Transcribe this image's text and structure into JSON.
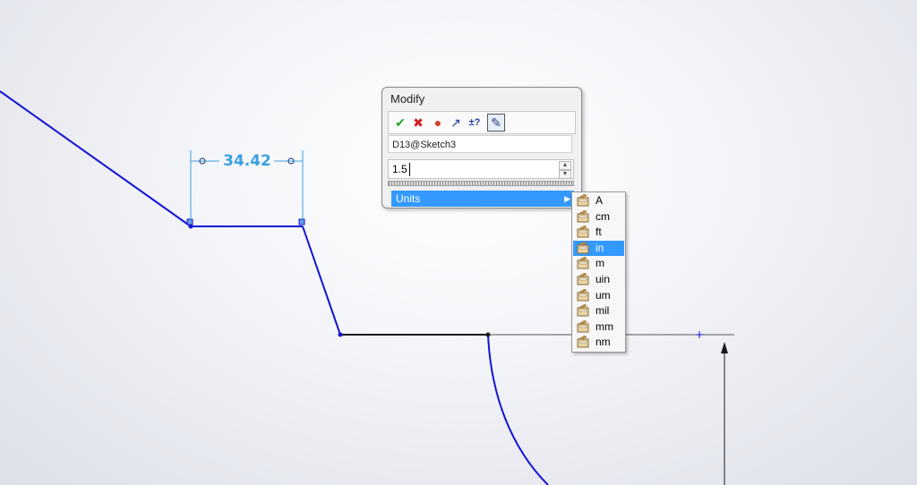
{
  "dimension": {
    "value_label": "34.42"
  },
  "modify_dialog": {
    "title": "Modify",
    "toolbar": [
      {
        "name": "ok-check-icon",
        "glyph": "✔",
        "color": "#2aa02a"
      },
      {
        "name": "cancel-x-icon",
        "glyph": "✖",
        "color": "#d02020"
      },
      {
        "name": "rebuild-traffic-light-icon",
        "glyph": "●",
        "color": "#d04030"
      },
      {
        "name": "reverse-dimension-icon",
        "glyph": "↗",
        "color": "#2040a0"
      },
      {
        "name": "tolerance-icon",
        "glyph": "±?",
        "color": "#2040a0"
      },
      {
        "name": "mark-for-drawing-icon",
        "glyph": "✎",
        "color": "#304080"
      }
    ],
    "dimension_name": "D13@Sketch3",
    "value": "1.5",
    "units_label": "Units",
    "units_arrow": "▶"
  },
  "units_menu": {
    "items": [
      {
        "label": "A",
        "selected": false
      },
      {
        "label": "cm",
        "selected": false
      },
      {
        "label": "ft",
        "selected": false
      },
      {
        "label": "in",
        "selected": true
      },
      {
        "label": "m",
        "selected": false
      },
      {
        "label": "uin",
        "selected": false
      },
      {
        "label": "um",
        "selected": false
      },
      {
        "label": "mil",
        "selected": false
      },
      {
        "label": "mm",
        "selected": false
      },
      {
        "label": "nm",
        "selected": false
      }
    ]
  },
  "colors": {
    "sketch_line": "#1414d2",
    "dimension": "#3aa0e0",
    "highlight": "#3399ff"
  }
}
